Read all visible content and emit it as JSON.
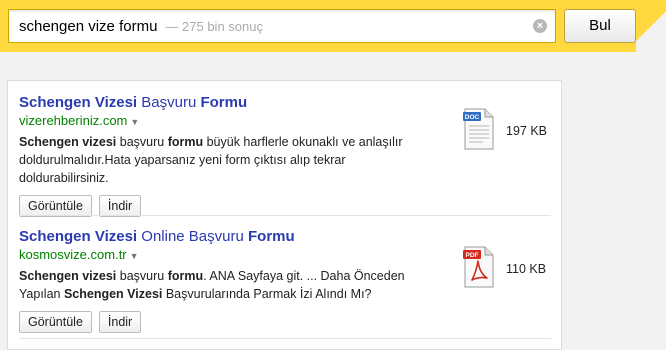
{
  "search": {
    "query": "schengen vize formu",
    "result_count": "— 275 bin sonuç",
    "button_label": "Bul"
  },
  "results": [
    {
      "title_parts": [
        {
          "text": "Schengen Vizesi",
          "bold": true
        },
        {
          "text": " Başvuru ",
          "bold": false
        },
        {
          "text": "Formu",
          "bold": true
        }
      ],
      "url": "vizerehberiniz.com",
      "snippet_parts": [
        {
          "text": "Schengen vizesi",
          "bold": true
        },
        {
          "text": " başvuru ",
          "bold": false
        },
        {
          "text": "formu",
          "bold": true
        },
        {
          "text": " büyük harflerle okunaklı ve anlaşılır doldurulmalıdır.Hata yaparsanız yeni form çıktısı alıp tekrar doldurabilirsiniz.",
          "bold": false
        }
      ],
      "file_type": "DOC",
      "file_size": "197 KB",
      "view_label": "Görüntüle",
      "download_label": "İndir"
    },
    {
      "title_parts": [
        {
          "text": "Schengen Vizesi",
          "bold": true
        },
        {
          "text": " Online Başvuru ",
          "bold": false
        },
        {
          "text": "Formu",
          "bold": true
        }
      ],
      "url": "kosmosvize.com.tr",
      "snippet_parts": [
        {
          "text": "Schengen vizesi",
          "bold": true
        },
        {
          "text": " başvuru ",
          "bold": false
        },
        {
          "text": "formu",
          "bold": true
        },
        {
          "text": ". ANA Sayfaya git. ... Daha Önceden Yapılan ",
          "bold": false
        },
        {
          "text": "Schengen Vizesi",
          "bold": true
        },
        {
          "text": " Başvurularında Parmak İzi Alındı Mı?",
          "bold": false
        }
      ],
      "file_type": "PDF",
      "file_size": "110 KB",
      "view_label": "Görüntüle",
      "download_label": "İndir"
    }
  ],
  "colors": {
    "header": "#ffd93d",
    "link": "#2b3bb0",
    "url": "#008000",
    "doc_badge": "#2f6fc3",
    "pdf_badge": "#d42a1e"
  },
  "icons": {
    "clear": "clear-icon",
    "doc": "doc-file-icon",
    "pdf": "pdf-file-icon"
  }
}
